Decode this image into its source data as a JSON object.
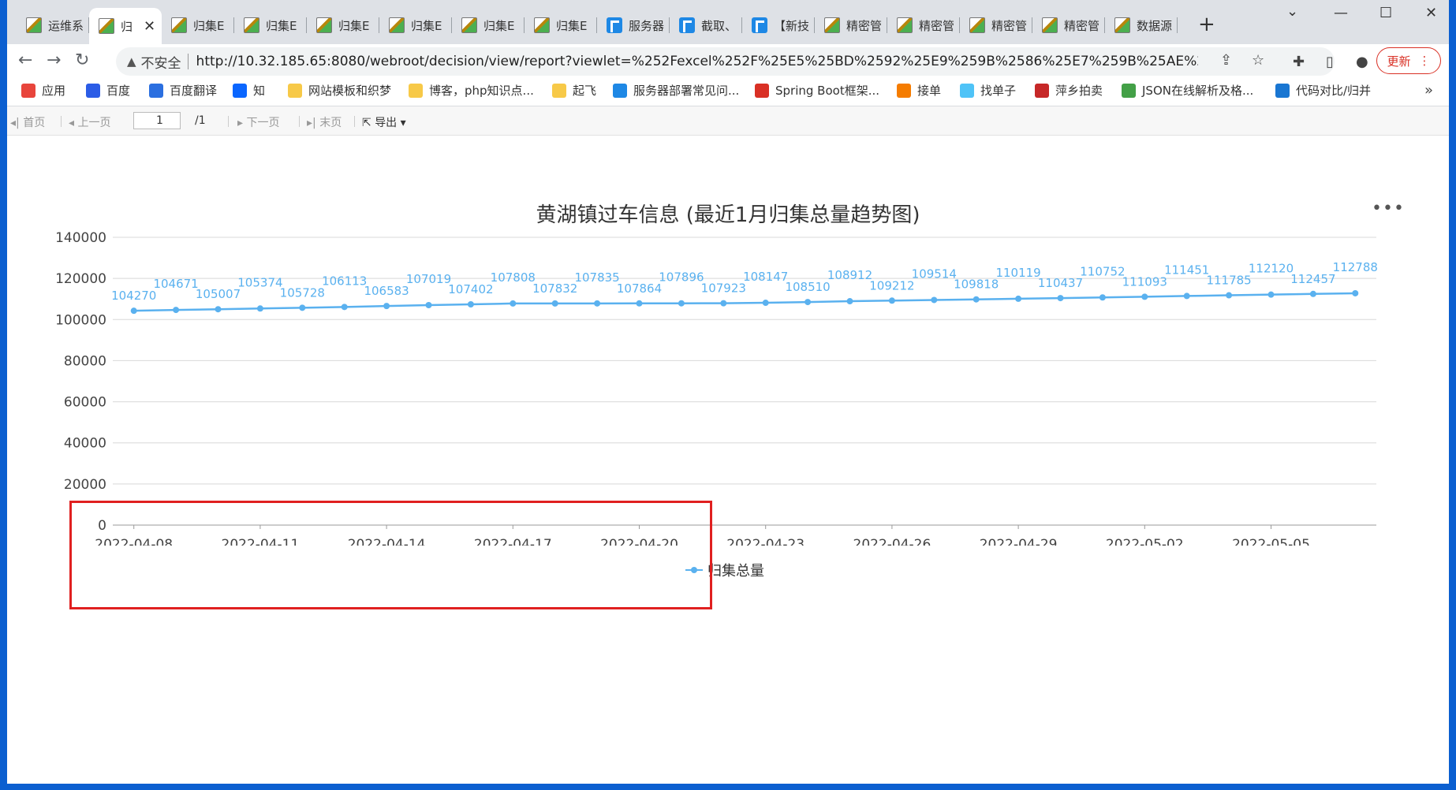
{
  "browser": {
    "tabs": [
      {
        "title": "运维系",
        "icon": "broken-image-icon"
      },
      {
        "title": "归",
        "icon": "broken-image-icon",
        "active": true
      },
      {
        "title": "归集E",
        "icon": "broken-image-icon"
      },
      {
        "title": "归集E",
        "icon": "broken-image-icon"
      },
      {
        "title": "归集E",
        "icon": "broken-image-icon"
      },
      {
        "title": "归集E",
        "icon": "broken-image-icon"
      },
      {
        "title": "归集E",
        "icon": "broken-image-icon"
      },
      {
        "title": "归集E",
        "icon": "broken-image-icon"
      },
      {
        "title": "服务器",
        "icon": "finereport-icon"
      },
      {
        "title": "截取、",
        "icon": "finereport-icon"
      },
      {
        "title": "【新技",
        "icon": "finereport-icon"
      },
      {
        "title": "精密管",
        "icon": "broken-image-icon"
      },
      {
        "title": "精密管",
        "icon": "broken-image-icon"
      },
      {
        "title": "精密管",
        "icon": "broken-image-icon"
      },
      {
        "title": "精密管",
        "icon": "broken-image-icon"
      },
      {
        "title": "数据源",
        "icon": "broken-image-icon"
      }
    ],
    "address": {
      "security_label": "不安全",
      "url": "http://10.32.185.65:8080/webroot/decision/view/report?viewlet=%252Fexcel%252F%25E5%25BD%2592%25E9%259B%2586%25E7%259B%25AE%25..."
    },
    "update_label": "更新",
    "bookmarks": [
      {
        "label": "应用",
        "color": "#e8453c"
      },
      {
        "label": "百度",
        "color": "#2b5ce6"
      },
      {
        "label": "百度翻译",
        "color": "#2b6fe0"
      },
      {
        "label": "知",
        "color": "#0a66ff"
      },
      {
        "label": "网站模板和织梦",
        "color": "#f7c948"
      },
      {
        "label": "博客，php知识点...",
        "color": "#f7c948"
      },
      {
        "label": "起飞",
        "color": "#f7c948"
      },
      {
        "label": "服务器部署常见问...",
        "color": "#1e88e5"
      },
      {
        "label": "Spring Boot框架...",
        "color": "#d93025"
      },
      {
        "label": "接单",
        "color": "#f57c00"
      },
      {
        "label": "找单子",
        "color": "#4fc3f7"
      },
      {
        "label": "萍乡拍卖",
        "color": "#c62828"
      },
      {
        "label": "JSON在线解析及格...",
        "color": "#43a047"
      },
      {
        "label": "代码对比/归并",
        "color": "#1976d2"
      }
    ],
    "bookmarks_more": "»"
  },
  "report_toolbar": {
    "first_page": "首页",
    "prev_page": "上一页",
    "page_value": "1",
    "page_total": "/1",
    "next_page": "下一页",
    "last_page": "末页",
    "export": "导出"
  },
  "chart_data": {
    "type": "line",
    "title": "黄湖镇过车信息 (最近1月归集总量趋势图)",
    "xlabel": "",
    "ylabel": "",
    "ylim": [
      0,
      140000
    ],
    "yticks": [
      0,
      20000,
      40000,
      60000,
      80000,
      100000,
      120000,
      140000
    ],
    "x_tick_labels": [
      "2022-04-08",
      "2022-04-11",
      "2022-04-14",
      "2022-04-17",
      "2022-04-20",
      "2022-04-23",
      "2022-04-26",
      "2022-04-29",
      "2022-05-02",
      "2022-05-05"
    ],
    "x": [
      "2022-04-08",
      "2022-04-09",
      "2022-04-10",
      "2022-04-11",
      "2022-04-12",
      "2022-04-13",
      "2022-04-14",
      "2022-04-15",
      "2022-04-16",
      "2022-04-17",
      "2022-04-18",
      "2022-04-19",
      "2022-04-20",
      "2022-04-21",
      "2022-04-22",
      "2022-04-23",
      "2022-04-24",
      "2022-04-25",
      "2022-04-26",
      "2022-04-27",
      "2022-04-28",
      "2022-04-29",
      "2022-04-30",
      "2022-05-01",
      "2022-05-02",
      "2022-05-03",
      "2022-05-04",
      "2022-05-05",
      "2022-05-06",
      "2022-05-07"
    ],
    "series": [
      {
        "name": "归集总量",
        "color": "#5ab1ef",
        "values": [
          104270,
          104671,
          105007,
          105374,
          105728,
          106113,
          106583,
          107019,
          107402,
          107808,
          107832,
          107835,
          107864,
          107896,
          107923,
          108147,
          108510,
          108912,
          109212,
          109514,
          109818,
          110119,
          110437,
          110752,
          111093,
          111451,
          111785,
          112120,
          112457,
          112788
        ]
      }
    ],
    "grid": true,
    "legend_position": "bottom-center"
  },
  "annotation": {
    "color": "#e02020"
  }
}
